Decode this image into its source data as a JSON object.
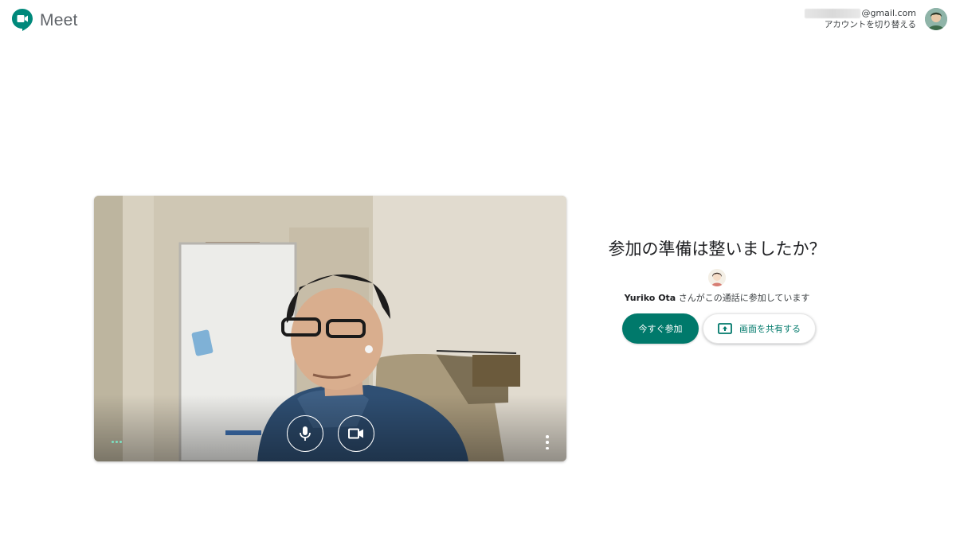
{
  "app": {
    "name": "Meet"
  },
  "account": {
    "email_suffix": "@gmail.com",
    "switch_label": "アカウントを切り替える"
  },
  "lobby": {
    "title": "参加の準備は整いましたか？",
    "participant_name": "Yuriko Ota",
    "participant_suffix": " さんがこの通話に参加しています",
    "join_label": "今すぐ参加",
    "present_label": "画面を共有する"
  },
  "controls": {
    "mic_icon": "microphone-icon",
    "camera_icon": "videocam-icon",
    "more_icon": "more-vert-icon",
    "audio_indicator_icon": "audio-level-dots-icon"
  },
  "colors": {
    "accent": "#00796b",
    "indicator": "#7ce0c2"
  }
}
